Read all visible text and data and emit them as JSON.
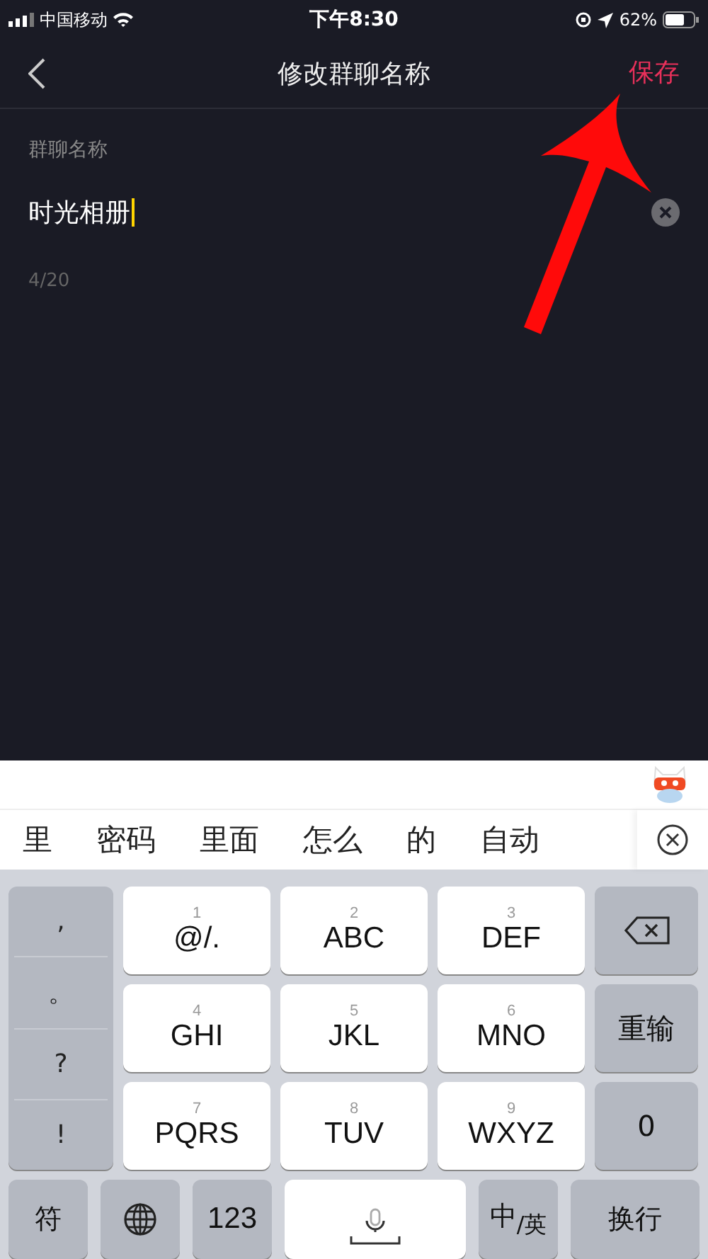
{
  "status_bar": {
    "carrier": "中国移动",
    "time": "下午8:30",
    "battery": "62%"
  },
  "nav": {
    "title": "修改群聊名称",
    "action": "保存"
  },
  "form": {
    "label": "群聊名称",
    "value": "时光相册",
    "counter": "4/20"
  },
  "keyboard": {
    "candidates": [
      "里",
      "密码",
      "里面",
      "怎么",
      "的",
      "自动"
    ],
    "punctuation": [
      ",",
      "。",
      "?",
      "!"
    ],
    "keys": [
      {
        "digit": "1",
        "letters": "@/."
      },
      {
        "digit": "2",
        "letters": "ABC"
      },
      {
        "digit": "3",
        "letters": "DEF"
      },
      {
        "digit": "4",
        "letters": "GHI"
      },
      {
        "digit": "5",
        "letters": "JKL"
      },
      {
        "digit": "6",
        "letters": "MNO"
      },
      {
        "digit": "7",
        "letters": "PQRS"
      },
      {
        "digit": "8",
        "letters": "TUV"
      },
      {
        "digit": "9",
        "letters": "WXYZ"
      }
    ],
    "side_keys": [
      {
        "kind": "delete"
      },
      {
        "kind": "text",
        "label": "重输"
      },
      {
        "kind": "text",
        "label": "0"
      }
    ],
    "bottom_keys": [
      {
        "kind": "text",
        "label": "符"
      },
      {
        "kind": "globe"
      },
      {
        "kind": "text",
        "label": "123"
      },
      {
        "kind": "space"
      },
      {
        "kind": "text",
        "label": "中$_{/英}$"
      },
      {
        "kind": "text",
        "label": "换行"
      }
    ]
  }
}
